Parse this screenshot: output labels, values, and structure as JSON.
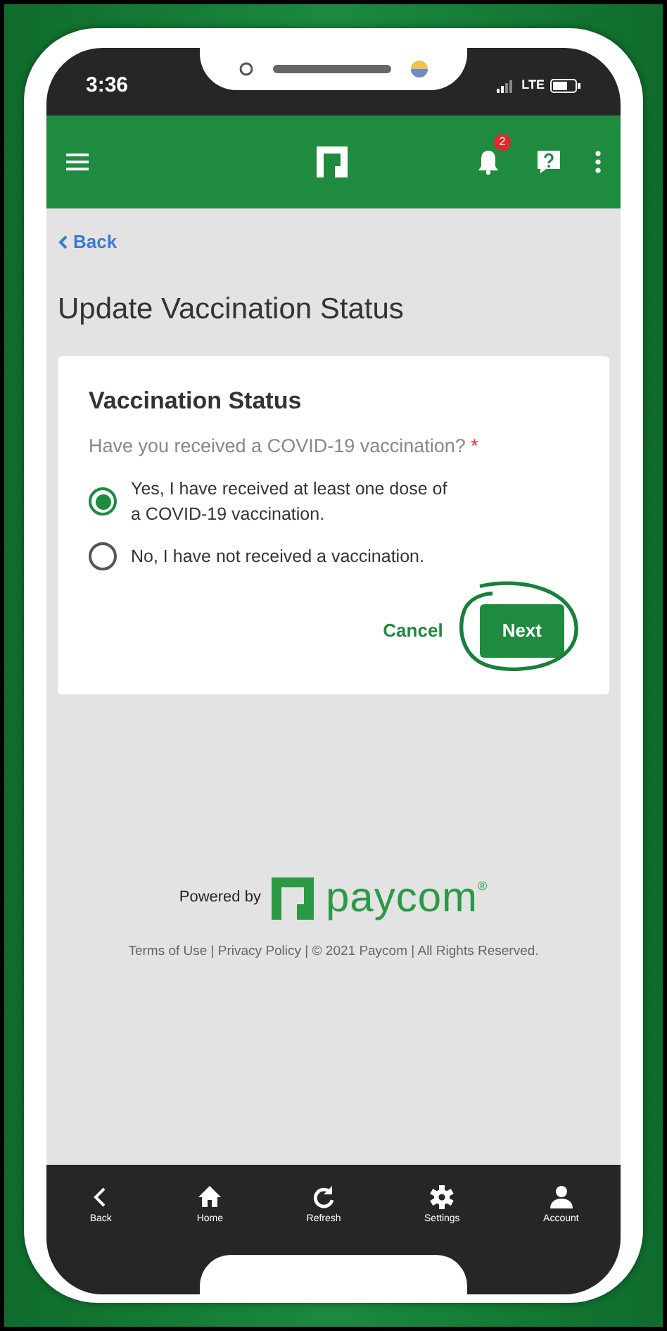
{
  "status_bar": {
    "time": "3:36",
    "network": "LTE"
  },
  "header": {
    "notification_count": "2"
  },
  "back_link": "Back",
  "page_title": "Update Vaccination Status",
  "card": {
    "title": "Vaccination Status",
    "question": "Have you received a COVID-19 vaccination?",
    "required_mark": "*",
    "options": [
      {
        "label": "Yes, I have received at least one dose of a COVID-19 vaccination.",
        "selected": true
      },
      {
        "label": "No, I have not received a vaccination.",
        "selected": false
      }
    ],
    "buttons": [
      {
        "label": "Cancel",
        "kind": "link",
        "circled": false
      },
      {
        "label": "Next",
        "kind": "primary",
        "circled": true
      }
    ]
  },
  "footer": {
    "powered_by": "Powered by",
    "brand": "paycom$^{®}$",
    "legal": "Terms of Use | Privacy Policy | © 2021 Paycom | All Rights Reserved."
  },
  "bottom_nav": [
    {
      "label": "Back",
      "kind": "back"
    },
    {
      "label": "Home",
      "kind": "home"
    },
    {
      "label": "Refresh",
      "kind": "refresh"
    },
    {
      "label": "Settings",
      "kind": "settings"
    },
    {
      "label": "Account",
      "kind": "account"
    }
  ]
}
